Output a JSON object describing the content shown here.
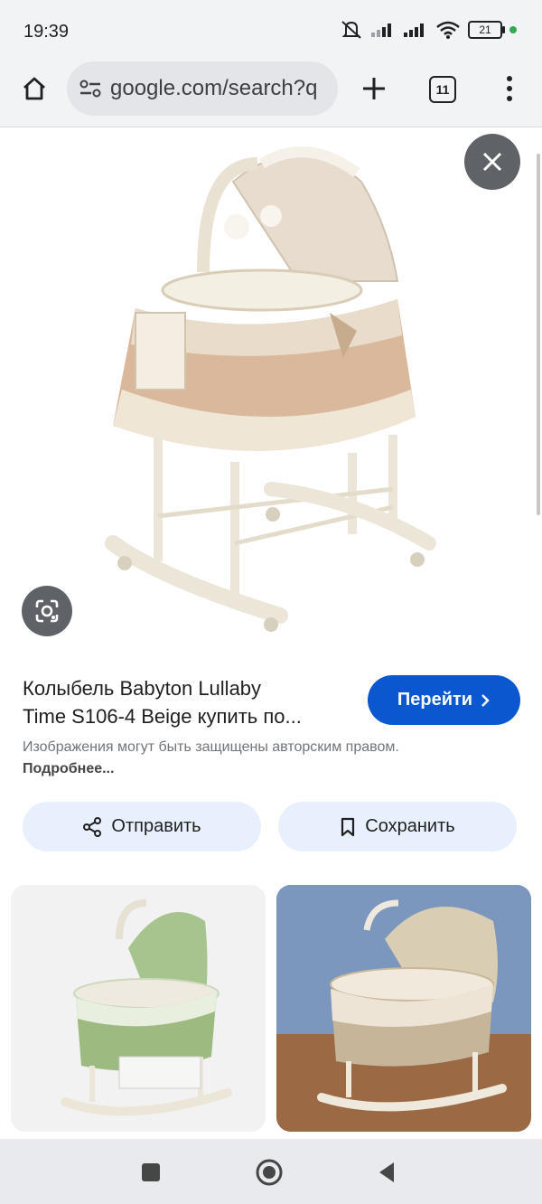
{
  "status_bar": {
    "time": "19:39",
    "battery": "21"
  },
  "toolbar": {
    "url": "google.com/search?q",
    "tab_count": "11"
  },
  "result": {
    "title_line1": "Колыбель Babyton Lullaby",
    "title_line2": "Time S106-4 Beige купить по...",
    "go_label": "Перейти",
    "copyright_text": "Изображения могут быть защищены авторским правом.",
    "more_link": "Подробнее..."
  },
  "actions": {
    "share_label": "Отправить",
    "save_label": "Сохранить"
  },
  "icons": {
    "home": "home-icon",
    "tune": "tune-icon",
    "plus": "plus-icon",
    "close": "close-icon",
    "lens": "lens-icon",
    "share": "share-icon",
    "bookmark": "bookmark-icon",
    "chevron": "chevron-right-icon",
    "wifi": "wifi-icon",
    "signal": "signal-icon",
    "mute": "mute-icon",
    "stop": "square-nav-icon",
    "home_nav": "circle-nav-icon",
    "back": "back-nav-icon"
  },
  "colors": {
    "accent": "#0b57d0",
    "chip": "#e8f0fe",
    "overlay": "#5f6368",
    "status_dot": "#34a853"
  }
}
